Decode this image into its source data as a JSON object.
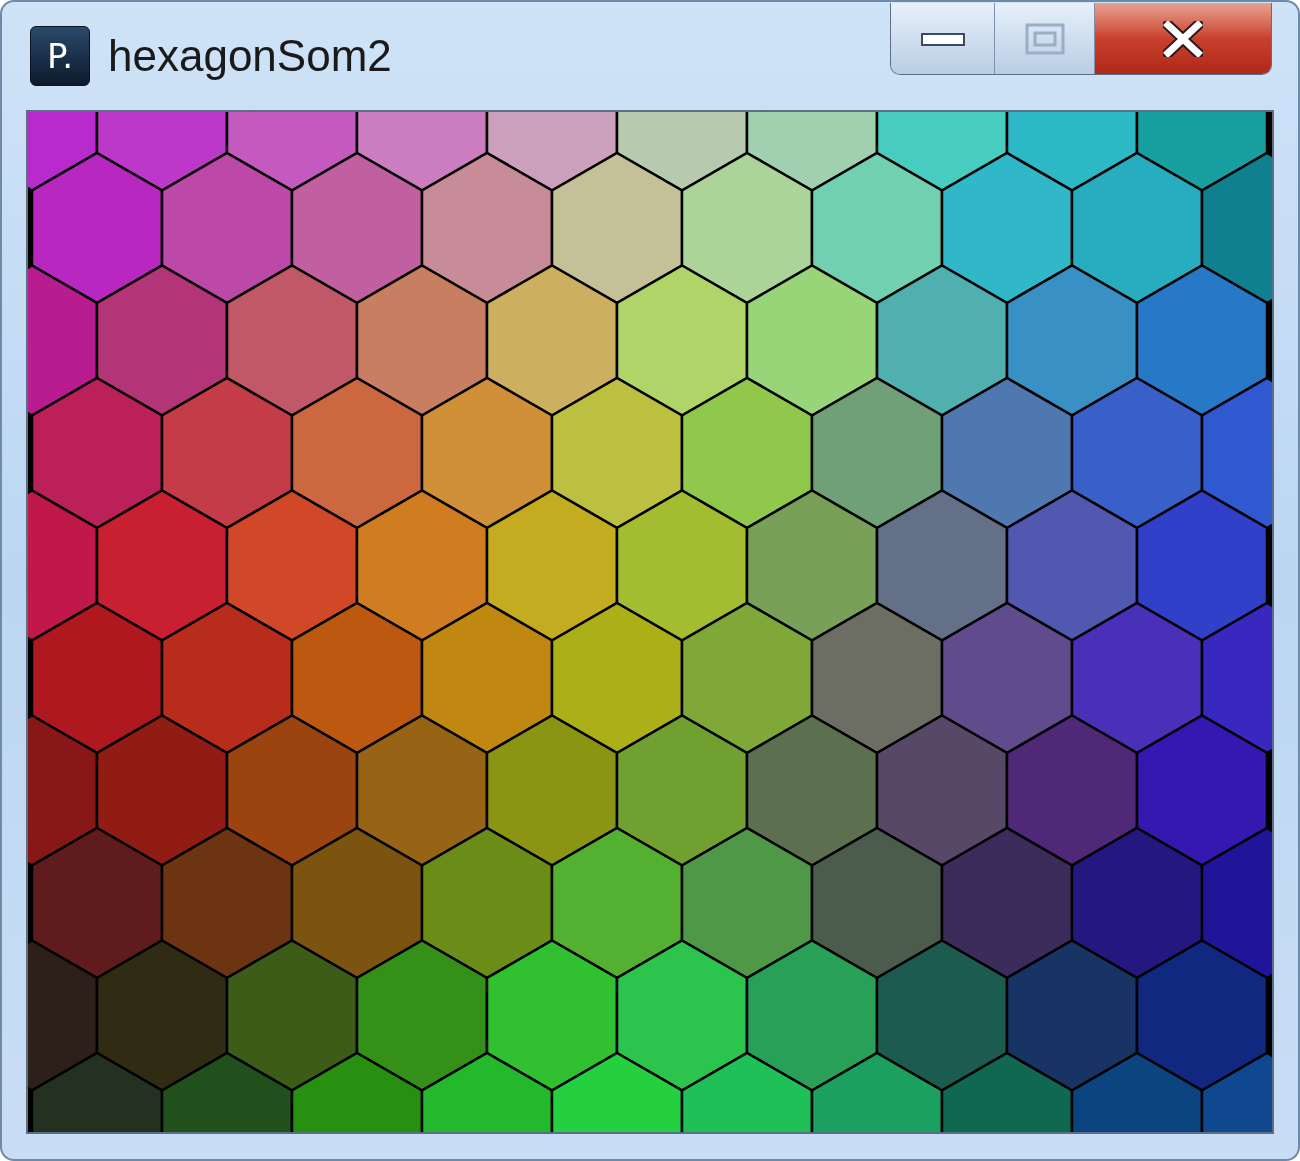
{
  "window": {
    "title": "hexagonSom2",
    "app_icon_label": "P."
  }
}
